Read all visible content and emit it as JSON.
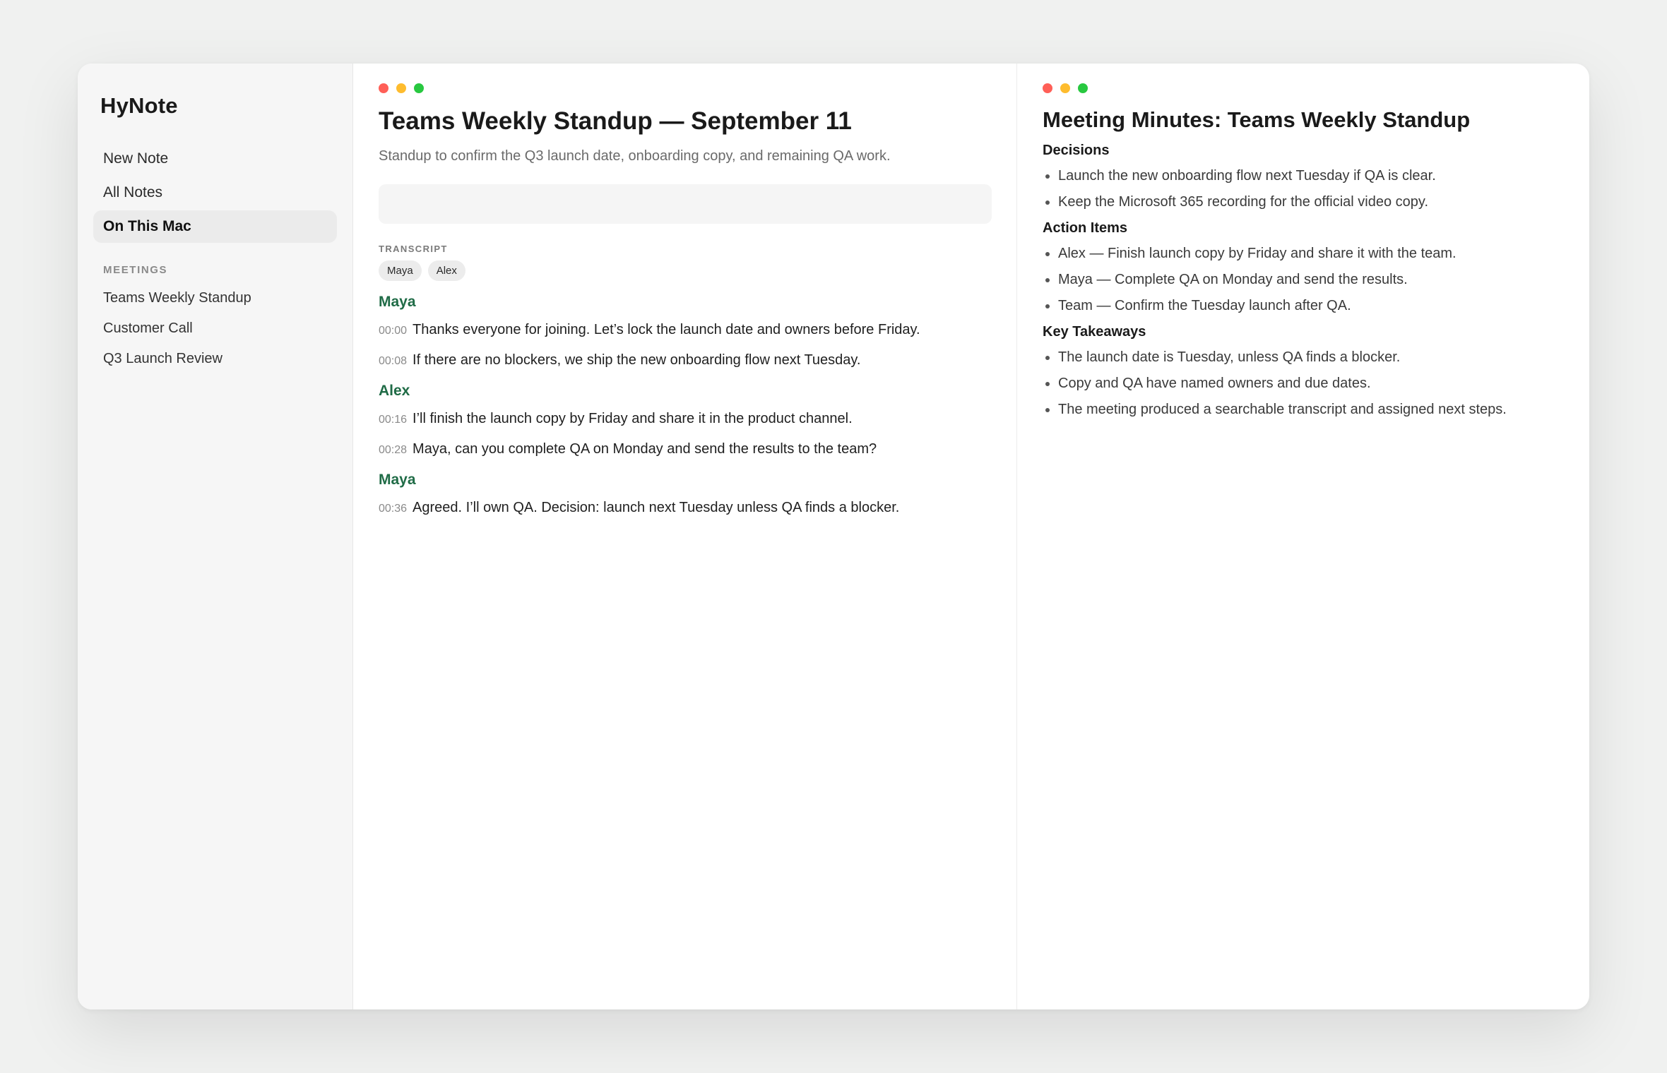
{
  "app": {
    "name": "HyNote"
  },
  "sidebar": {
    "nav": [
      {
        "label": "New Note"
      },
      {
        "label": "All Notes"
      },
      {
        "label": "On This Mac"
      }
    ],
    "section_label": "MEETINGS",
    "meetings": [
      {
        "label": "Teams Weekly Standup"
      },
      {
        "label": "Customer Call"
      },
      {
        "label": "Q3 Launch Review"
      }
    ]
  },
  "colors": {
    "close": "#ff5f57",
    "minimize": "#febc2e",
    "maximize": "#28c840",
    "speaker": "#1f6b46"
  },
  "main": {
    "title": "Teams Weekly Standup — September 11",
    "subtitle": "Standup to confirm the Q3 launch date, onboarding copy, and remaining QA work.",
    "input": {
      "value": "",
      "placeholder": ""
    },
    "transcript_label": "TRANSCRIPT",
    "participants": [
      "Maya",
      "Alex"
    ],
    "transcript": [
      {
        "speaker": "Maya",
        "lines": [
          {
            "time": "00:00",
            "text": "Thanks everyone for joining. Let’s lock the launch date and owners before Friday."
          },
          {
            "time": "00:08",
            "text": "If there are no blockers, we ship the new onboarding flow next Tuesday."
          }
        ]
      },
      {
        "speaker": "Alex",
        "lines": [
          {
            "time": "00:16",
            "text": "I’ll finish the launch copy by Friday and share it in the product channel."
          },
          {
            "time": "00:28",
            "text": "Maya, can you complete QA on Monday and send the results to the team?"
          }
        ]
      },
      {
        "speaker": "Maya",
        "lines": [
          {
            "time": "00:36",
            "text": "Agreed. I’ll own QA. Decision: launch next Tuesday unless QA finds a blocker."
          }
        ]
      }
    ]
  },
  "minutes": {
    "title": "Meeting Minutes: Teams Weekly Standup",
    "sections": [
      {
        "heading": "Decisions",
        "items": [
          "Launch the new onboarding flow next Tuesday if QA is clear.",
          "Keep the Microsoft 365 recording for the official video copy."
        ]
      },
      {
        "heading": "Action Items",
        "items": [
          "Alex — Finish launch copy by Friday and share it with the team.",
          "Maya — Complete QA on Monday and send the results.",
          "Team — Confirm the Tuesday launch after QA."
        ]
      },
      {
        "heading": "Key Takeaways",
        "items": [
          "The launch date is Tuesday, unless QA finds a blocker.",
          "Copy and QA have named owners and due dates.",
          "The meeting produced a searchable transcript and assigned next steps."
        ]
      }
    ]
  }
}
